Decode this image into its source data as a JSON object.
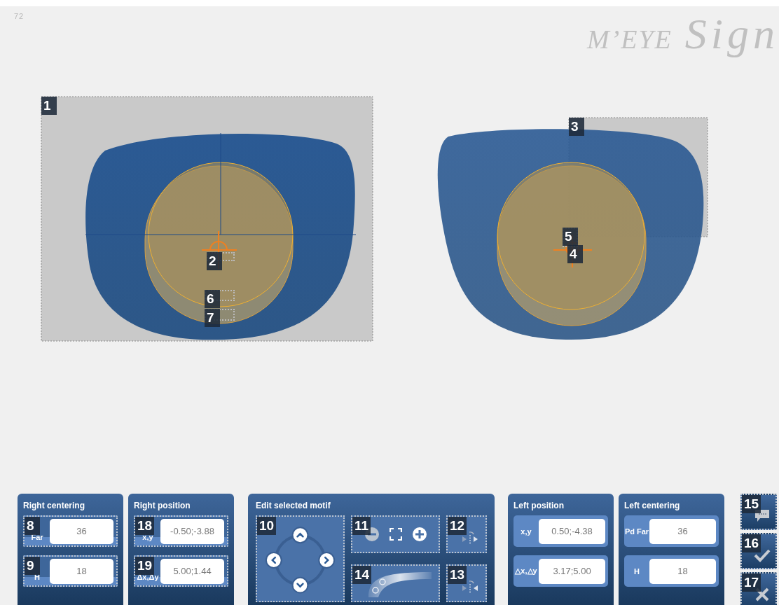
{
  "page_number": "72",
  "logo": {
    "brand": "M’EYE",
    "product": "Sign"
  },
  "canvas": {
    "markers": [
      {
        "number": "1"
      },
      {
        "number": "2"
      },
      {
        "number": "3"
      },
      {
        "number": "4"
      },
      {
        "number": "5"
      },
      {
        "number": "6"
      },
      {
        "number": "7"
      }
    ]
  },
  "panels": [
    {
      "kind": "fields",
      "title": "Right centering",
      "fields": [
        {
          "label": "Far",
          "value": "36",
          "marker": "8"
        },
        {
          "label": "H",
          "value": "18",
          "marker": "9"
        }
      ]
    },
    {
      "kind": "fields",
      "title": "Right position",
      "fields": [
        {
          "label": "x,y",
          "value": "-0.50;-3.88",
          "marker": "18"
        },
        {
          "label": "Δx,Δy",
          "value": "5.00;1.44",
          "marker": "19"
        }
      ]
    },
    {
      "kind": "motif",
      "title": "Edit selected motif",
      "controls": [
        {
          "kind": "pad",
          "marker": "10"
        },
        {
          "kind": "zoom",
          "marker": "11"
        },
        {
          "kind": "mirror",
          "marker": "12"
        },
        {
          "kind": "arc",
          "marker": "14"
        },
        {
          "kind": "flip",
          "marker": "13"
        }
      ]
    },
    {
      "kind": "fields",
      "title": "Left position",
      "fields": [
        {
          "label": "x,y",
          "value": "0.50;-4.38"
        },
        {
          "label": "△x,△y",
          "value": "3.17;5.00"
        }
      ]
    },
    {
      "kind": "fields",
      "title": "Left centering",
      "fields": [
        {
          "label": "Pd Far",
          "value": "36"
        },
        {
          "label": "H",
          "value": "18"
        }
      ]
    }
  ],
  "side_buttons": [
    {
      "kind": "comment",
      "marker": "15"
    },
    {
      "kind": "confirm",
      "marker": "16"
    },
    {
      "kind": "cancel",
      "marker": "17"
    }
  ]
}
